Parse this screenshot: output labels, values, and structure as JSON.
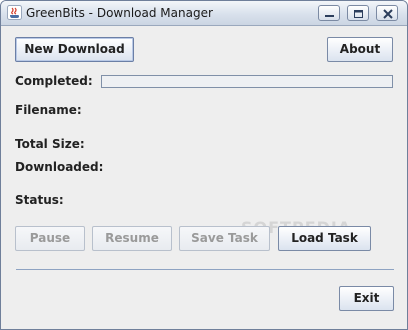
{
  "window": {
    "title": "GreenBits - Download Manager",
    "controls": {
      "minimize_icon": "minimize-icon",
      "maximize_icon": "maximize-icon",
      "close_icon": "close-icon"
    }
  },
  "toolbar": {
    "new_download_label": "New Download",
    "about_label": "About"
  },
  "info": {
    "completed_label": "Completed:",
    "completed_progress": 0,
    "filename_label": "Filename:",
    "total_size_label": "Total Size:",
    "downloaded_label": "Downloaded:",
    "status_label": "Status:"
  },
  "actions": {
    "pause_label": "Pause",
    "resume_label": "Resume",
    "save_task_label": "Save Task",
    "load_task_label": "Load Task"
  },
  "footer": {
    "exit_label": "Exit"
  },
  "watermark": "SOFTPEDIA",
  "colors": {
    "accent": "#7a8aa6",
    "window_bg": "#eeeeee",
    "separator": "#8ea3c2"
  }
}
